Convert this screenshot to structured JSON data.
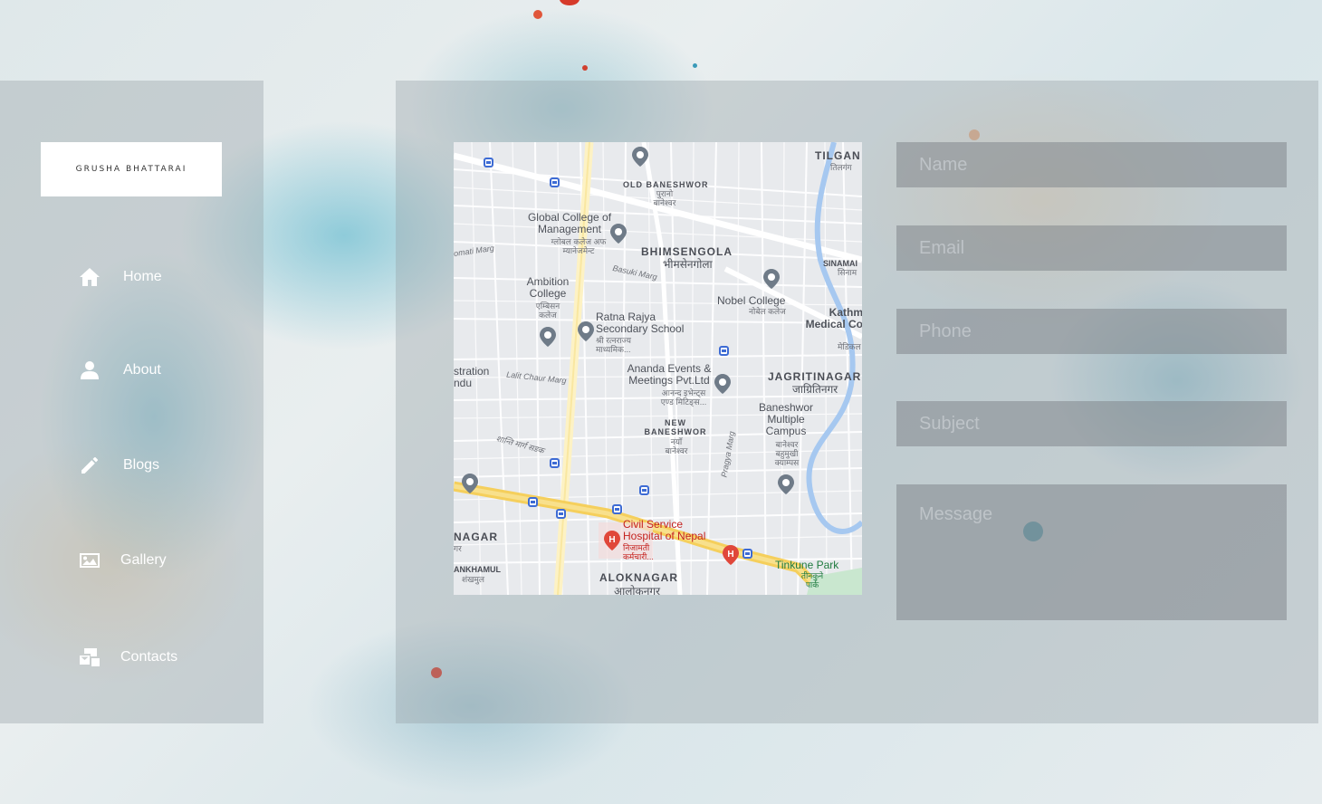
{
  "sidebar": {
    "logo_text": "GRUSHA BHATTARAI",
    "nav": [
      {
        "label": "Home",
        "icon": "home-icon"
      },
      {
        "label": "About",
        "icon": "user-icon"
      },
      {
        "label": "Blogs",
        "icon": "pencil-icon"
      },
      {
        "label": "Gallery",
        "icon": "image-icon"
      },
      {
        "label": "Contacts",
        "icon": "contacts-icon"
      }
    ]
  },
  "map": {
    "labels": {
      "tilgan": "TILGAN",
      "tilgan_dev": "तिलगंग",
      "old_baneshwor": "OLD BANESHWOR",
      "old_baneshwor_dev": "पुरानो बानेश्वर",
      "global_college": "Global College of Management",
      "global_college_dev": "ग्लोबल कलेज अफ म्यानेजमेन्ट",
      "bhimsengola": "BHIMSENGOLA",
      "bhimsengola_dev": "भीमसेनगोला",
      "basuki_marg": "Basuki Marg",
      "sinamangal": "SINAMAI",
      "sinamangal_dev": "सिनाम",
      "gomati_marg": "omati Marg",
      "ambition_college": "Ambition College",
      "ambition_college_dev": "एम्बिसन कलेज",
      "nobel_college": "Nobel College",
      "nobel_college_dev": "नोबेल कलेज",
      "kathmandu_medical": "Kathm Medical Co",
      "kathmandu_medical_dev": "मेडिकल",
      "ratna_rajya": "Ratna Rajya Secondary School",
      "ratna_rajya_dev": "श्री रत्नराज्य माध्यमिक...",
      "ananda_events": "Ananda Events & Meetings Pvt.Ltd",
      "ananda_events_dev": "आनन्द इभेन्ट्स एण्ड मिटिङ्स...",
      "jagritinagar": "JAGRITINAGAR",
      "jagritinagar_dev": "जाग्रितिनगर",
      "stration": "stration ndu",
      "lalita_chaur": "Lalit Chaur Marg",
      "new_baneshwor": "NEW BANESHWOR",
      "new_baneshwor_dev": "नयाँ बानेश्वर",
      "baneshwor_campus": "Baneshwor Multiple Campus",
      "baneshwor_campus_dev": "बानेश्वर बहुमुखी क्याम्पस",
      "shanti_marg": "शान्ति मार्ग सडक",
      "pragya_marg": "Pragya Marg",
      "civil_service": "Civil Service Hospital of Nepal",
      "civil_service_dev": "निजामती कर्मचारी...",
      "nagar": "NAGAR",
      "nagar_dev": "गर",
      "ankhamul": "ANKHAMUL",
      "ankhamul_dev": "शंखमुल",
      "aloknagar": "ALOKNAGAR",
      "aloknagar_dev": "आलोकनगर",
      "tinkune_park": "Tinkune Park",
      "tinkune_park_dev": "तीनकुने पार्क"
    }
  },
  "form": {
    "name_placeholder": "Name",
    "email_placeholder": "Email",
    "phone_placeholder": "Phone",
    "subject_placeholder": "Subject",
    "message_placeholder": "Message"
  }
}
